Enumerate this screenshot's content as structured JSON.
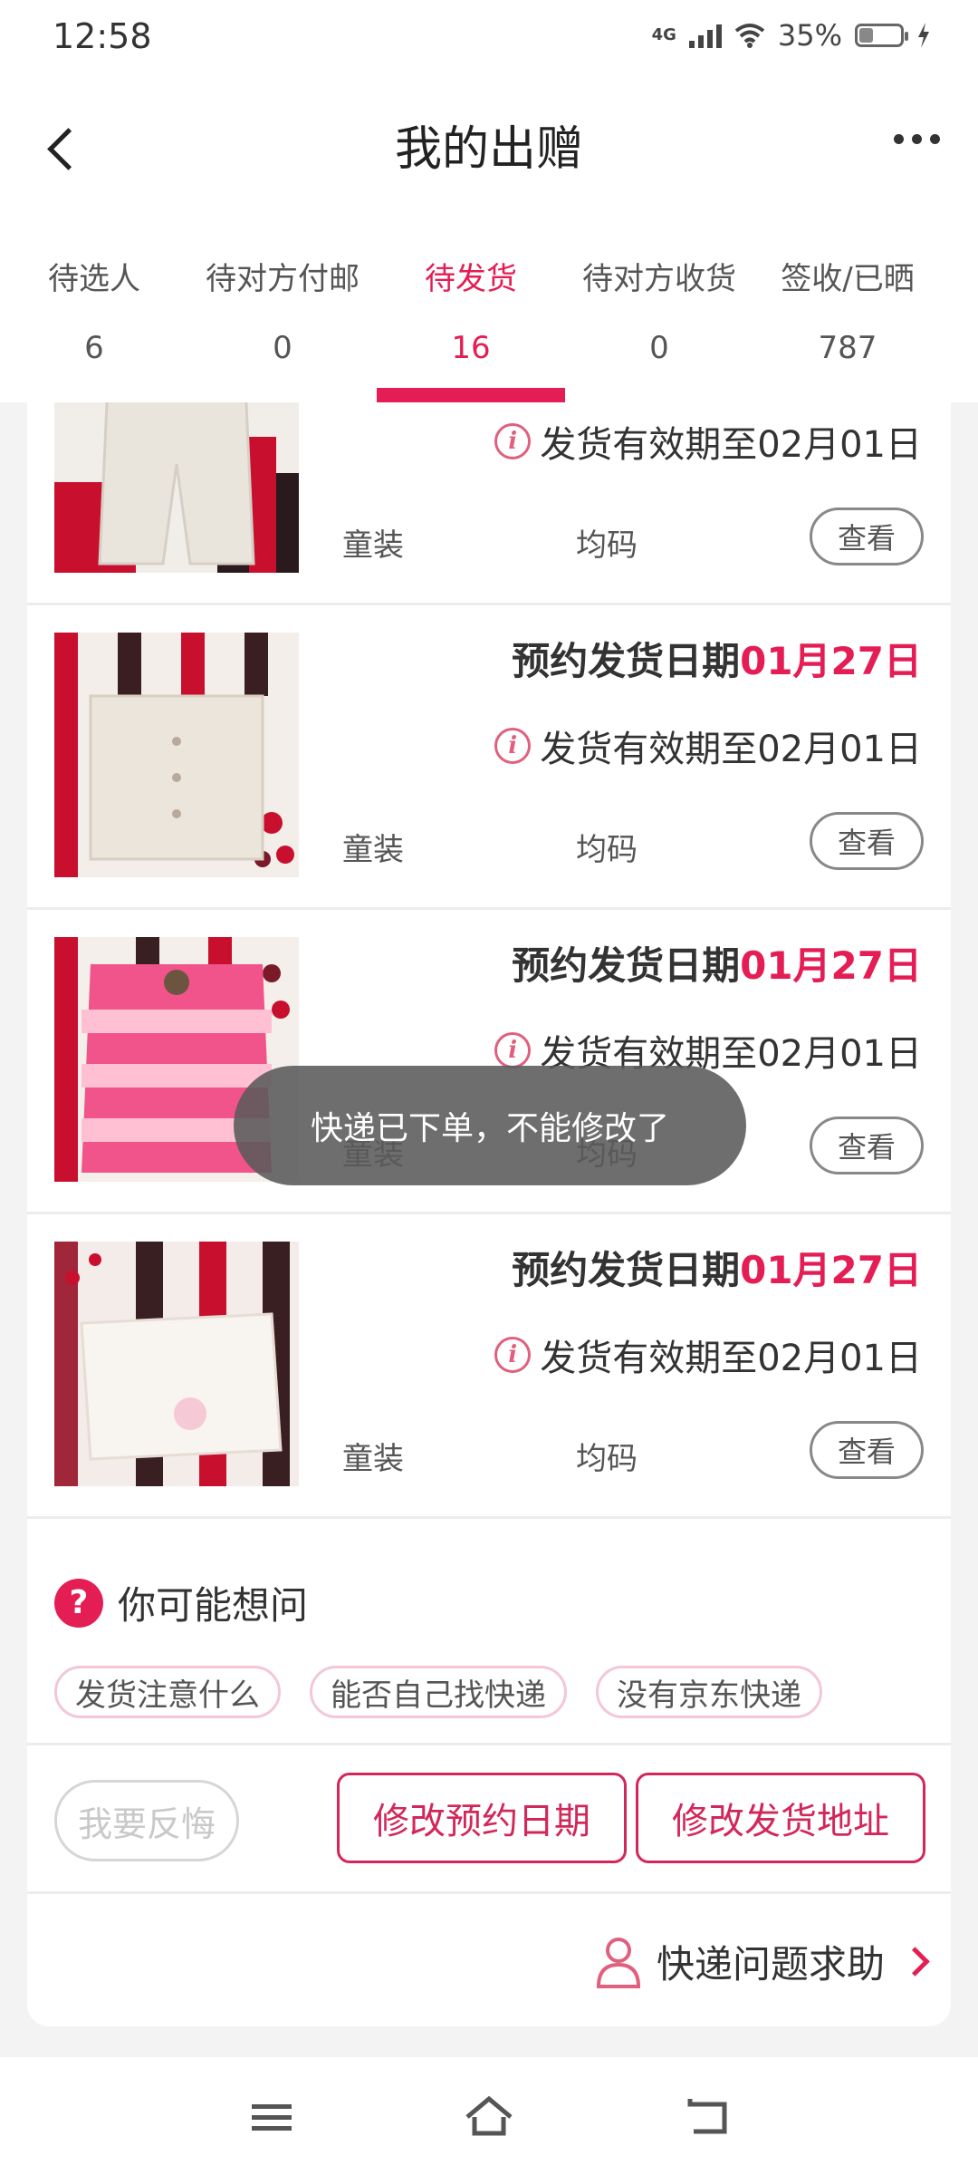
{
  "status_bar": {
    "time": "12:58",
    "network": "4G",
    "battery_percent": "35%",
    "battery_level": 0.35
  },
  "header": {
    "title": "我的出赠"
  },
  "tabs": [
    {
      "label": "待选人",
      "count": "6",
      "active": false
    },
    {
      "label": "待对方付邮",
      "count": "0",
      "active": false
    },
    {
      "label": "待发货",
      "count": "16",
      "active": true
    },
    {
      "label": "待对方收货",
      "count": "0",
      "active": false
    },
    {
      "label": "签收/已晒",
      "count": "787",
      "active": false
    }
  ],
  "items": [
    {
      "schedule_label": "",
      "schedule_date": "",
      "validity": "发货有效期至02月01日",
      "category": "童装",
      "size": "均码",
      "view_label": "查看"
    },
    {
      "schedule_label": "预约发货日期",
      "schedule_date": "01月27日",
      "validity": "发货有效期至02月01日",
      "category": "童装",
      "size": "均码",
      "view_label": "查看"
    },
    {
      "schedule_label": "预约发货日期",
      "schedule_date": "01月27日",
      "validity": "发货有效期至02月01日",
      "category": "童装",
      "size": "均码",
      "view_label": "查看"
    },
    {
      "schedule_label": "预约发货日期",
      "schedule_date": "01月27日",
      "validity": "发货有效期至02月01日",
      "category": "童装",
      "size": "均码",
      "view_label": "查看"
    }
  ],
  "faq": {
    "title": "你可能想问",
    "chips": [
      "发货注意什么",
      "能否自己找快递",
      "没有京东快递"
    ]
  },
  "actions": {
    "regret": "我要反悔",
    "change_date": "修改预约日期",
    "change_address": "修改发货地址"
  },
  "help": {
    "label": "快递问题求助"
  },
  "toast": {
    "message": "快递已下单，不能修改了"
  },
  "colors": {
    "accent": "#e51d55",
    "button_border": "#d2275a",
    "background": "#f3f3f3"
  }
}
